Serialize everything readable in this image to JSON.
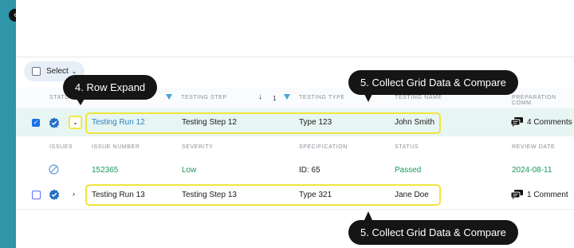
{
  "select_button": {
    "label": "Select"
  },
  "columns": {
    "status": "STATUS",
    "testing_step": "TESTING STEP",
    "sort_index": "1",
    "testing_type": "TESTING TYPE",
    "testing_name": "TESTING NAME",
    "preparation": "PREPARATION COMM"
  },
  "rows": [
    {
      "testing_run": "Testing Run 12",
      "testing_step": "Testing Step 12",
      "testing_type": "Type 123",
      "name": "John Smith",
      "comments": "4 Comments",
      "selected": true,
      "expanded": true
    },
    {
      "testing_run": "Testing Run 13",
      "testing_step": "Testing Step 13",
      "testing_type": "Type 321",
      "name": "Jane Doe",
      "comments": "1 Comment",
      "selected": false,
      "expanded": false
    }
  ],
  "detail": {
    "headers": {
      "issues": "ISSUES",
      "issue_number": "ISSUE NUMBER",
      "severity": "SEVERITY",
      "specification": "SPECIFICATION",
      "status": "STATUS",
      "review_date": "REVIEW DATE"
    },
    "values": {
      "issue_number": "152365",
      "severity": "Low",
      "specification": "ID: 65",
      "status": "Passed",
      "review_date": "2024-08-11"
    }
  },
  "callouts": {
    "row_expand": "4. Row Expand",
    "collect_top": "5. Collect Grid Data & Compare",
    "collect_bottom": "5. Collect Grid Data & Compare"
  },
  "colors": {
    "rail": "#2f95a8",
    "highlight": "#f0e53c",
    "selected_row": "#e7f6f3",
    "accent_green": "#1a9a5a"
  }
}
